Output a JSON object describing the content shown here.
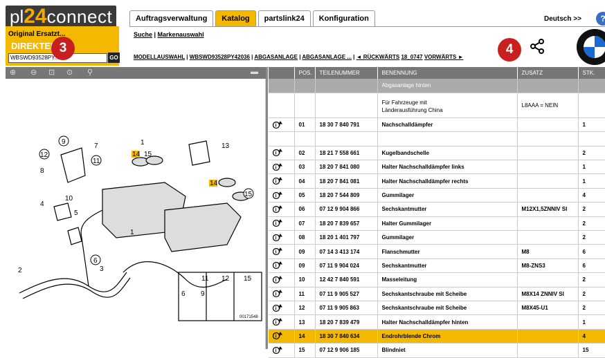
{
  "header": {
    "logo": {
      "a": "pl",
      "b": "24",
      "c": "connect"
    },
    "tabs": [
      "Auftragsverwaltung",
      "Katalog",
      "partslink24",
      "Konfiguration"
    ],
    "active_tab": 1,
    "language": "Deutsch >>",
    "help": "?"
  },
  "left_panel": {
    "label": "Original Ersatzt...",
    "direct": "DIREKTEI...EG",
    "vin": "WBSWD93528PY...",
    "go": "GO"
  },
  "badges": {
    "b3": "3",
    "b4": "4"
  },
  "links": {
    "search": "Suche",
    "sep": " | ",
    "brand": "Markenauswahl"
  },
  "breadcrumb": {
    "model": "MODELLAUSWAHL",
    "vin": "WBSWD93528PY42036",
    "group1": "ABGASANLAGE",
    "group2": "ABGASANLAGE ...",
    "back": "◄ RÜCKWÄRTS",
    "ref": "18_0747",
    "forward": "VORWÄRTS ►"
  },
  "diagram_labels": [
    "9",
    "7",
    "1",
    "15",
    "14",
    "13",
    "12",
    "11",
    "8",
    "10",
    "4",
    "5",
    "6",
    "1",
    "14",
    "15",
    "2",
    "3",
    "12",
    "11",
    "12",
    "15",
    "6",
    "9",
    "00171548"
  ],
  "table": {
    "headers": [
      "",
      "POS.",
      "TEILENUMMER",
      "BENENNUNG",
      "ZUSATZ",
      "STK."
    ],
    "section": "Abgasanlage hinten",
    "note": {
      "text1": "Für Fahrzeuge mit",
      "text2": "Länderausführung China",
      "zusatz": "L8AAA = NEIN"
    },
    "rows": [
      {
        "pos": "01",
        "nr": "18 30 7 840 791",
        "name": "Nachschalldämpfer",
        "zusatz": "",
        "stk": "1"
      },
      {
        "pos": "02",
        "nr": "18 21 7 558 661",
        "name": "Kugelbandschelle",
        "zusatz": "",
        "stk": "2"
      },
      {
        "pos": "03",
        "nr": "18 20 7 841 080",
        "name": "Halter Nachschalldämpfer links",
        "zusatz": "",
        "stk": "1"
      },
      {
        "pos": "04",
        "nr": "18 20 7 841 081",
        "name": "Halter Nachschalldämpfer rechts",
        "zusatz": "",
        "stk": "1"
      },
      {
        "pos": "05",
        "nr": "18 20 7 544 809",
        "name": "Gummilager",
        "zusatz": "",
        "stk": "4"
      },
      {
        "pos": "06",
        "nr": "07 12 9 904 866",
        "name": "Sechskantmutter",
        "zusatz": "M12X1,5ZNNIV SI",
        "stk": "2"
      },
      {
        "pos": "07",
        "nr": "18 20 7 839 657",
        "name": "Halter Gummilager",
        "zusatz": "",
        "stk": "2"
      },
      {
        "pos": "08",
        "nr": "18 20 1 401 797",
        "name": "Gummilager",
        "zusatz": "",
        "stk": "2"
      },
      {
        "pos": "09",
        "nr": "07 14 3 413 174",
        "name": "Flanschmutter",
        "zusatz": "M8",
        "stk": "6"
      },
      {
        "pos": "09",
        "nr": "07 11 9 904 024",
        "name": "Sechskantmutter",
        "zusatz": "M8-ZNS3",
        "stk": "6"
      },
      {
        "pos": "10",
        "nr": "12 42 7 840 591",
        "name": "Masseleitung",
        "zusatz": "",
        "stk": "2"
      },
      {
        "pos": "11",
        "nr": "07 11 9 905 527",
        "name": "Sechskantschraube mit Scheibe",
        "zusatz": "M8X14 ZNNIV SI",
        "stk": "2"
      },
      {
        "pos": "12",
        "nr": "07 11 9 905 863",
        "name": "Sechskantschraube mit Scheibe",
        "zusatz": "M8X45-U1",
        "stk": "2"
      },
      {
        "pos": "13",
        "nr": "18 20 7 839 479",
        "name": "Halter Nachschalldämpfer hinten",
        "zusatz": "",
        "stk": "1"
      },
      {
        "pos": "14",
        "nr": "18 30 7 840 634",
        "name": "Endrohrblende Chrom",
        "zusatz": "",
        "stk": "4",
        "highlight": true
      },
      {
        "pos": "15",
        "nr": "07 12 9 906 185",
        "name": "Blindniet",
        "zusatz": "",
        "stk": "15"
      }
    ]
  },
  "colors": {
    "accent": "#f5b800",
    "badge": "#c8201f",
    "header_bg": "#777777"
  },
  "icons": [
    "info-cart-icon",
    "share-icon",
    "bmw-logo",
    "zoom-in-icon",
    "zoom-out-icon",
    "zoom-fit-icon",
    "zoom-100-icon",
    "search-icon",
    "car-icon"
  ]
}
